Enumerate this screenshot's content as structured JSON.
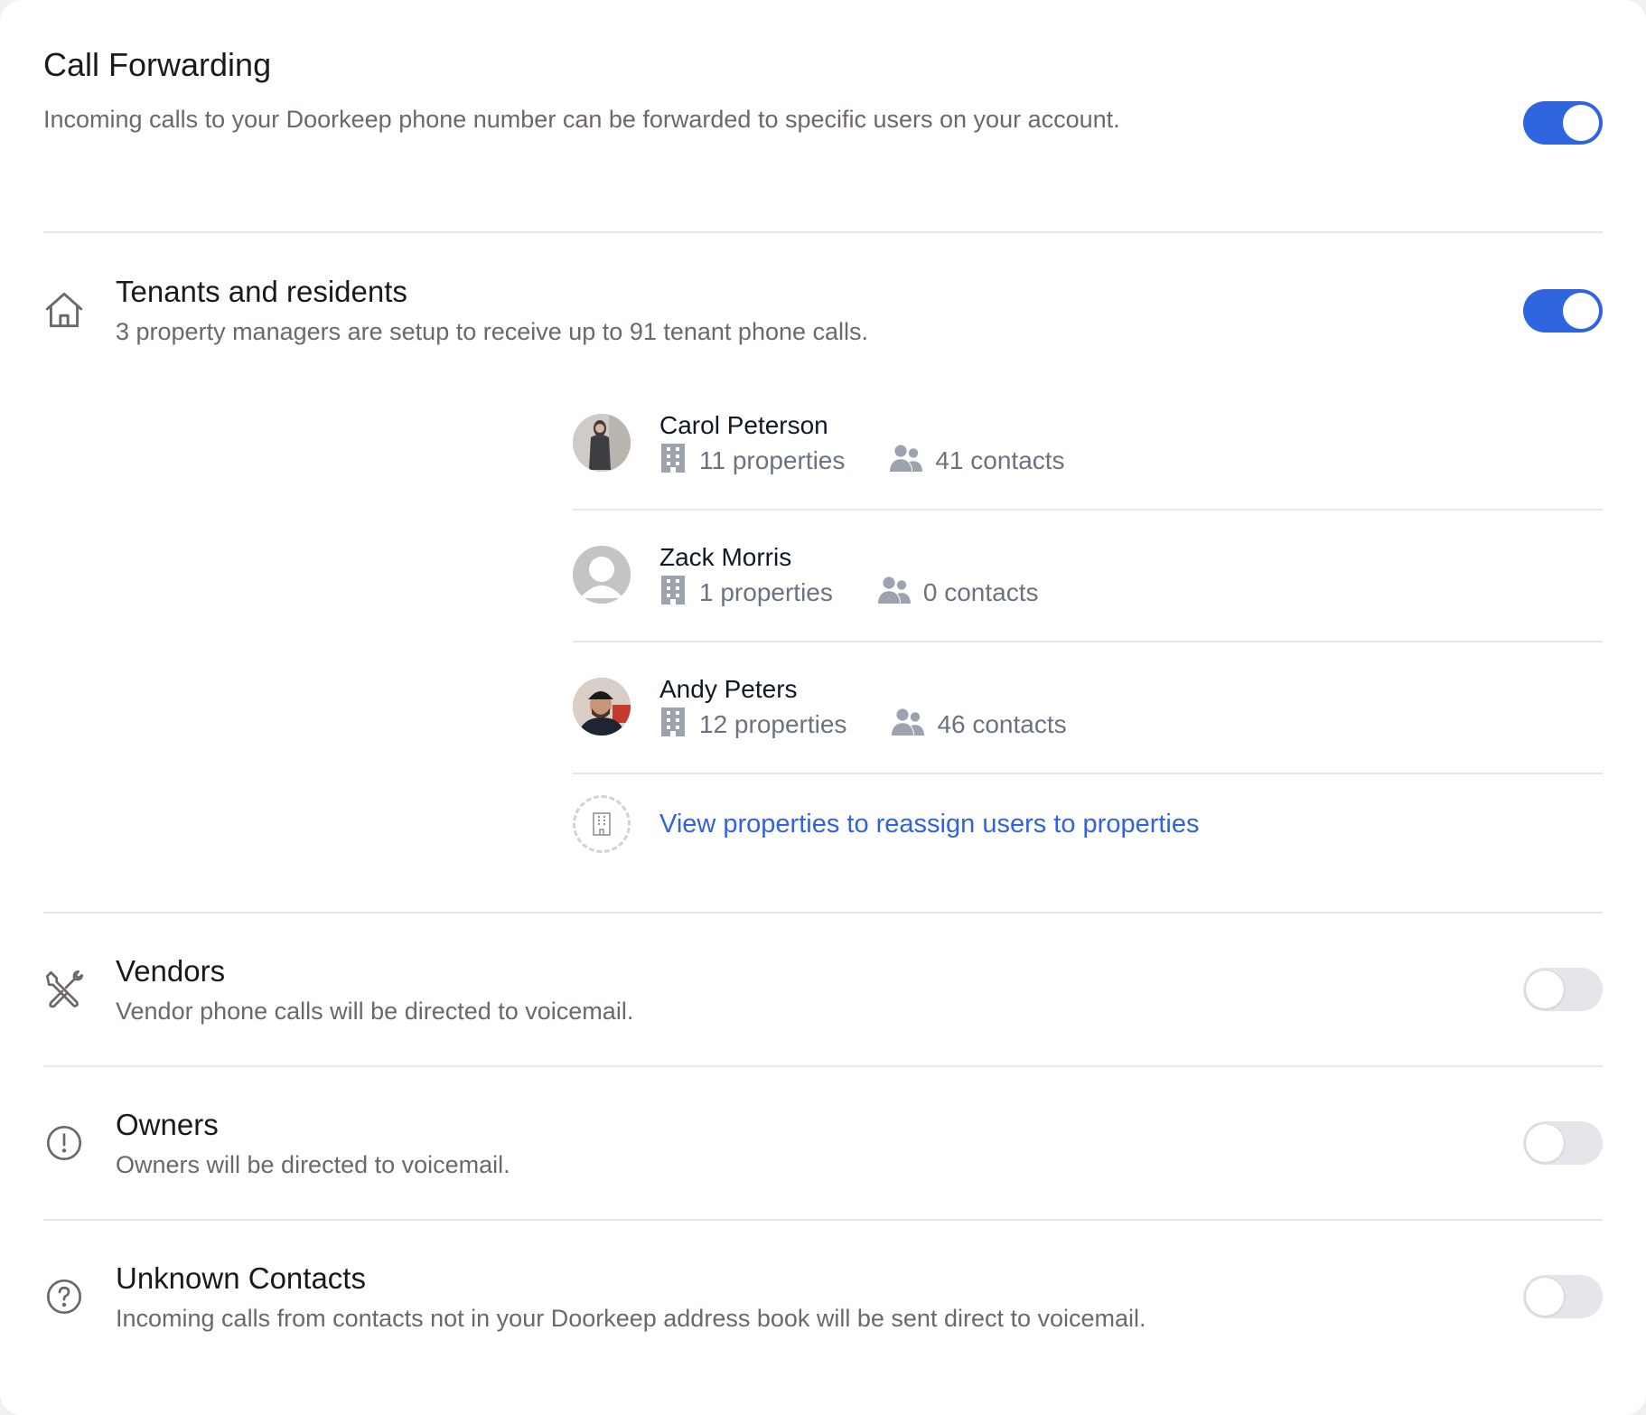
{
  "header": {
    "title": "Call Forwarding",
    "description": "Incoming calls to your Doorkeep phone number can be forwarded to specific users on your account.",
    "enabled": true
  },
  "colors": {
    "accent": "#2f66e0",
    "link": "#2f63e0",
    "toggle_off": "#e5e6ea",
    "muted_text": "#6d6864",
    "meta_icon": "#9ca3af"
  },
  "sections": {
    "tenants": {
      "icon": "home-icon",
      "title": "Tenants and residents",
      "description": "3 property managers are setup to receive up to 91 tenant phone calls.",
      "enabled": true,
      "users": [
        {
          "name": "Carol Peterson",
          "avatar": "photo",
          "properties": "11 properties",
          "contacts": "41 contacts"
        },
        {
          "name": "Zack Morris",
          "avatar": "placeholder-user-icon",
          "properties": "1 properties",
          "contacts": "0 contacts"
        },
        {
          "name": "Andy Peters",
          "avatar": "photo",
          "properties": "12 properties",
          "contacts": "46 contacts"
        }
      ],
      "link_label": "View properties to reassign users to properties"
    },
    "vendors": {
      "icon": "wrench-screwdriver-icon",
      "title": "Vendors",
      "description": "Vendor phone calls will be directed to voicemail.",
      "enabled": false
    },
    "owners": {
      "icon": "exclamation-circle-icon",
      "title": "Owners",
      "description": "Owners will be directed to voicemail.",
      "enabled": false
    },
    "unknown": {
      "icon": "question-circle-icon",
      "title": "Unknown Contacts",
      "description": "Incoming calls from contacts not in your Doorkeep address book will be sent direct to voicemail.",
      "enabled": false
    }
  }
}
